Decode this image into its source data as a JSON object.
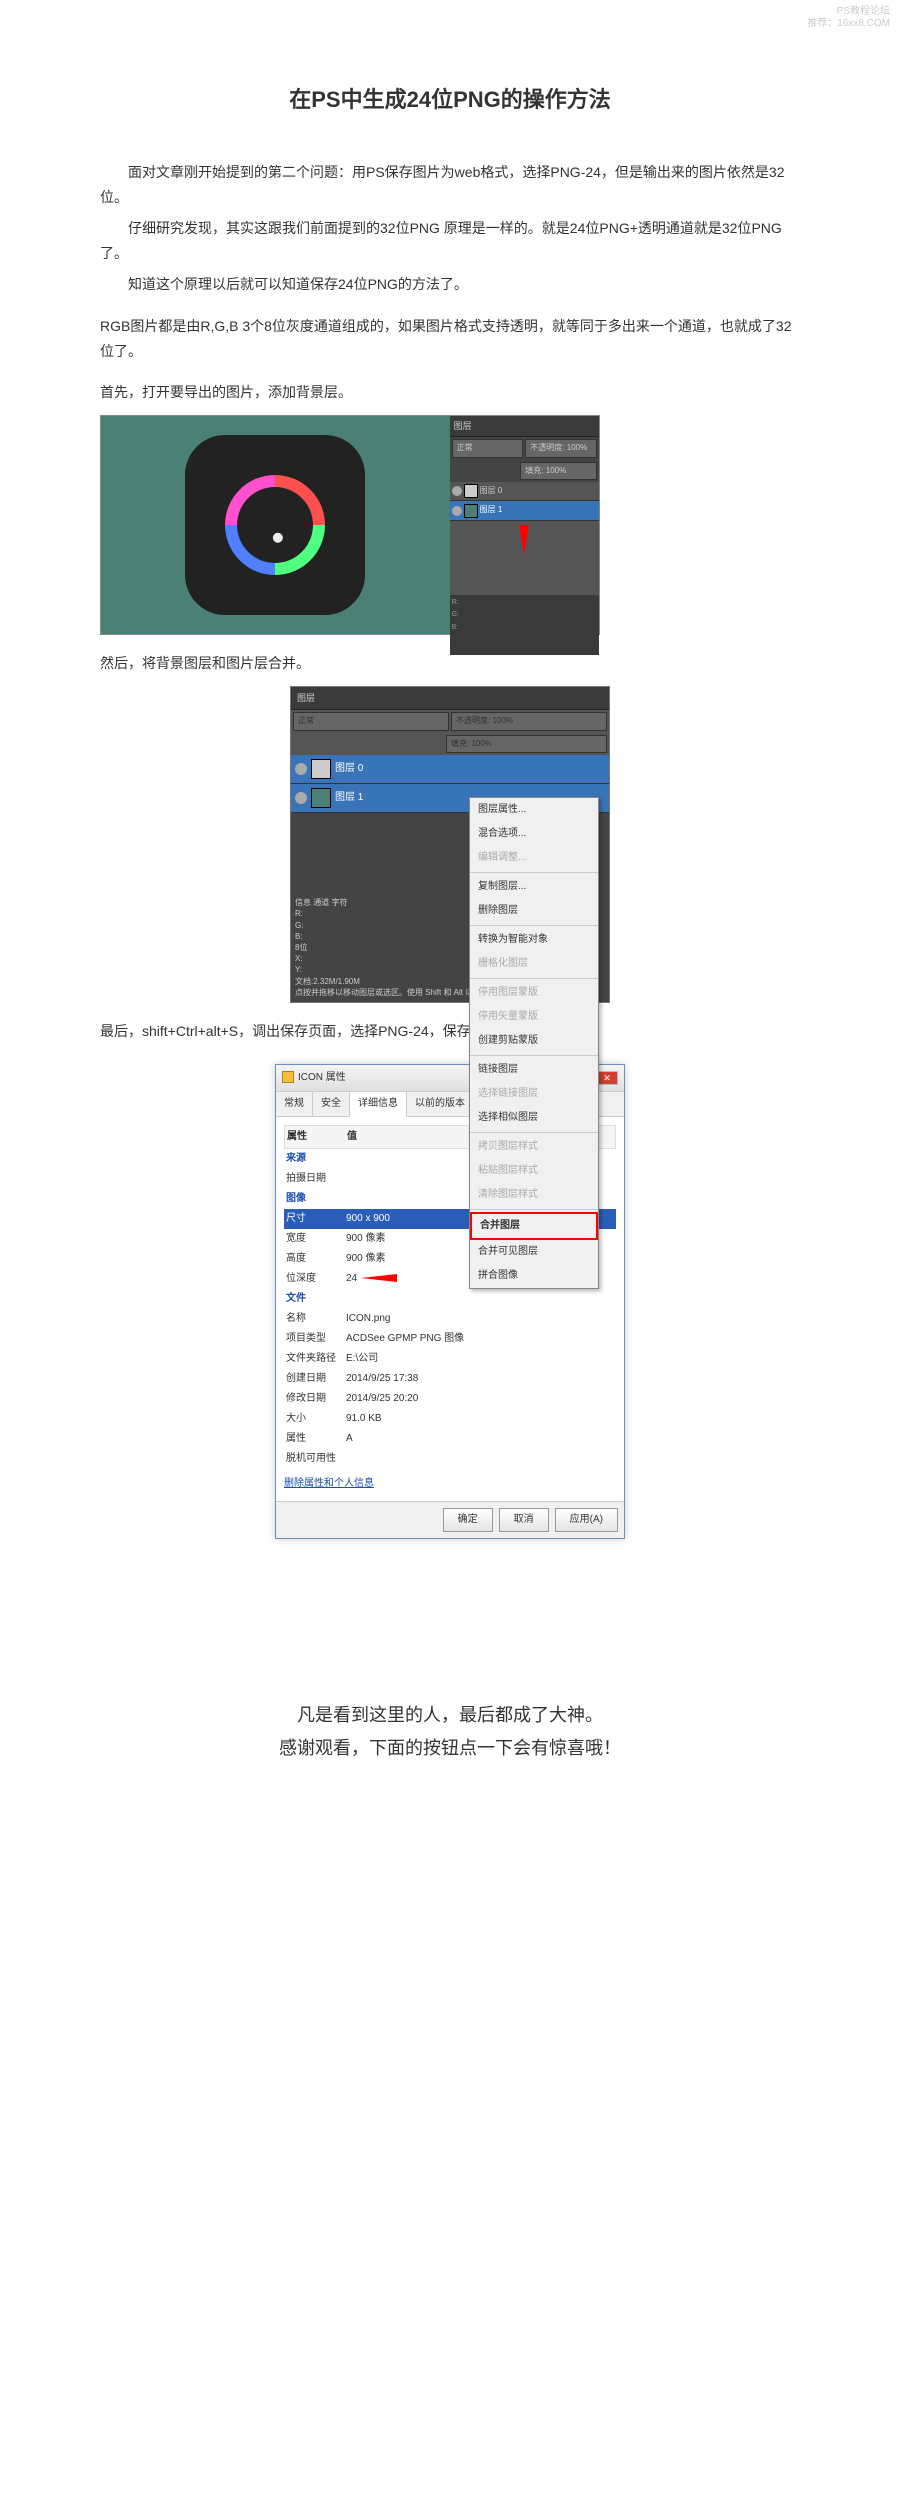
{
  "watermark": {
    "l1": "PS教程论坛",
    "l2": "推荐：16xx8.COM"
  },
  "title": "在PS中生成24位PNG的操作方法",
  "intro": [
    "面对文章刚开始提到的第二个问题：用PS保存图片为web格式，选择PNG-24，但是输出来的图片依然是32位。",
    "仔细研究发现，其实这跟我们前面提到的32位PNG 原理是一样的。就是24位PNG+透明通道就是32位PNG了。",
    "知道这个原理以后就可以知道保存24位PNG的方法了。"
  ],
  "rgbNote": "RGB图片都是由R,G,B 3个8位灰度通道组成的，如果图片格式支持透明，就等同于多出来一个通道，也就成了32位了。",
  "step1": "首先，打开要导出的图片，添加背景层。",
  "step2": "然后，将背景图层和图片层合并。",
  "step3": "最后，shift+Ctrl+alt+S，调出保存页面，选择PNG-24，保存即可。",
  "layersPanel": {
    "tab": "图层",
    "mode": "正常",
    "opacity": "不透明度: 100%",
    "fill": "填充: 100%",
    "layer0": "图层 0",
    "layer1": "图层 1"
  },
  "infoPanel": {
    "tabs": "信息  通道  字符",
    "rgb": "R:\nG:\nB:",
    "bit": "8位",
    "xy": "X:\nY:",
    "doc": "文档:2.32M/1.90M",
    "hint": "点按并拖移以移动图层或选区。使用 Shift 和 Alt 以"
  },
  "contextMenu": {
    "items": [
      {
        "t": "图层属性...",
        "dis": false
      },
      {
        "t": "混合选项...",
        "dis": false
      },
      {
        "t": "编辑调整...",
        "dis": true
      },
      {
        "t": "复制图层...",
        "dis": false
      },
      {
        "t": "删除图层",
        "dis": false
      },
      {
        "t": "转换为智能对象",
        "dis": false
      },
      {
        "t": "栅格化图层",
        "dis": true
      },
      {
        "t": "停用图层蒙版",
        "dis": true
      },
      {
        "t": "停用矢量蒙版",
        "dis": true
      },
      {
        "t": "创建剪贴蒙版",
        "dis": false
      },
      {
        "t": "链接图层",
        "dis": false
      },
      {
        "t": "选择链接图层",
        "dis": true
      },
      {
        "t": "选择相似图层",
        "dis": false
      },
      {
        "t": "拷贝图层样式",
        "dis": true
      },
      {
        "t": "粘贴图层样式",
        "dis": true
      },
      {
        "t": "清除图层样式",
        "dis": true
      },
      {
        "t": "合并图层",
        "dis": false,
        "hl": true
      },
      {
        "t": "合并可见图层",
        "dis": false
      },
      {
        "t": "拼合图像",
        "dis": false
      }
    ]
  },
  "dialog": {
    "title": "ICON 属性",
    "tabs": [
      "常规",
      "安全",
      "详细信息",
      "以前的版本"
    ],
    "activeTab": 2,
    "hdr": {
      "prop": "属性",
      "val": "值"
    },
    "sections": {
      "origin": "来源",
      "shot": "拍摄日期",
      "image": "图像",
      "file": "文件"
    },
    "rows": [
      {
        "k": "尺寸",
        "v": "900 x 900",
        "sel": true
      },
      {
        "k": "宽度",
        "v": "900 像素"
      },
      {
        "k": "高度",
        "v": "900 像素"
      },
      {
        "k": "位深度",
        "v": "24",
        "arrow": true
      }
    ],
    "fileRows": [
      {
        "k": "名称",
        "v": "ICON.png"
      },
      {
        "k": "项目类型",
        "v": "ACDSee GPMP PNG 图像"
      },
      {
        "k": "文件夹路径",
        "v": "E:\\公司"
      },
      {
        "k": "创建日期",
        "v": "2014/9/25 17:38"
      },
      {
        "k": "修改日期",
        "v": "2014/9/25 20:20"
      },
      {
        "k": "大小",
        "v": "91.0 KB"
      },
      {
        "k": "属性",
        "v": "A"
      },
      {
        "k": "脱机可用性",
        "v": ""
      }
    ],
    "link": "删除属性和个人信息",
    "buttons": {
      "ok": "确定",
      "cancel": "取消",
      "apply": "应用(A)"
    }
  },
  "ending": {
    "l1": "凡是看到这里的人，最后都成了大神。",
    "l2": "感谢观看，下面的按钮点一下会有惊喜哦！"
  }
}
